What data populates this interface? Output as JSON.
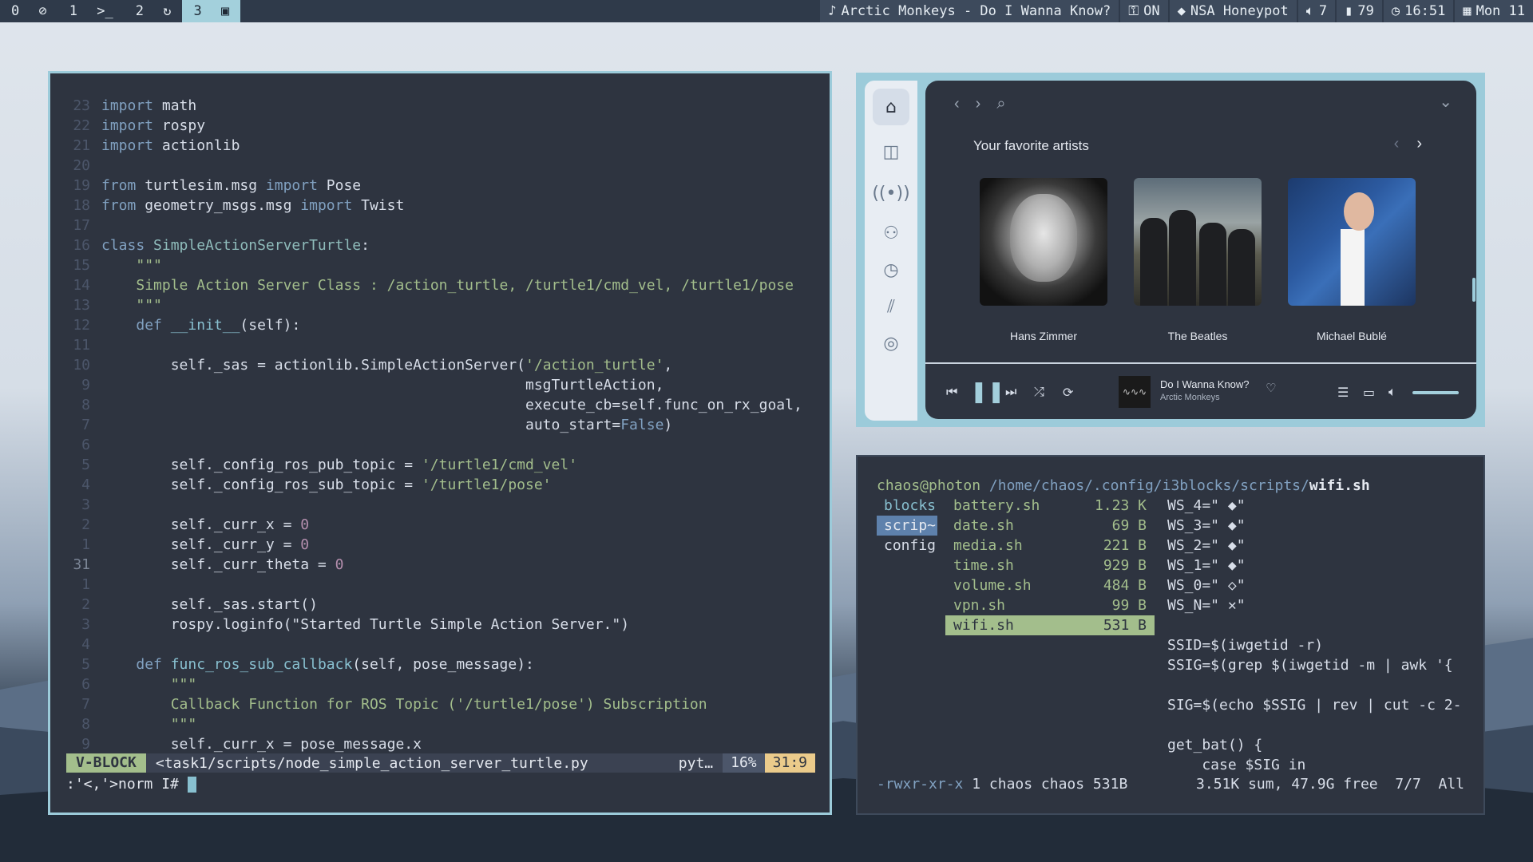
{
  "topbar": {
    "workspaces": [
      {
        "num": "0",
        "icon": "⊘"
      },
      {
        "num": "1",
        "icon": ">_"
      },
      {
        "num": "2",
        "icon": "↻"
      },
      {
        "num": "3",
        "icon": "▣",
        "active": true
      }
    ],
    "music": "Arctic Monkeys - Do I Wanna Know?",
    "vpn": "ON",
    "wifi": "NSA Honeypot",
    "volume": "7",
    "battery": "79",
    "time": "16:51",
    "date": "Mon 11"
  },
  "vim": {
    "lines": [
      {
        "n": "23",
        "c": "<span class=\"kw\">import</span> math"
      },
      {
        "n": "22",
        "c": "<span class=\"kw\">import</span> rospy"
      },
      {
        "n": "21",
        "c": "<span class=\"kw\">import</span> actionlib"
      },
      {
        "n": "20",
        "c": ""
      },
      {
        "n": "19",
        "c": "<span class=\"kw\">from</span> turtlesim.msg <span class=\"kw\">import</span> Pose"
      },
      {
        "n": "18",
        "c": "<span class=\"kw\">from</span> geometry_msgs.msg <span class=\"kw\">import</span> Twist"
      },
      {
        "n": "17",
        "c": ""
      },
      {
        "n": "16",
        "c": "<span class=\"kw\">class</span> <span class=\"cls\">SimpleActionServerTurtle</span>:"
      },
      {
        "n": "15",
        "c": "    <span class=\"doc\">\"\"\"</span>"
      },
      {
        "n": "14",
        "c": "    <span class=\"doc\">Simple Action Server Class : /action_turtle, /turtle1/cmd_vel, /turtle1/pose</span>"
      },
      {
        "n": "13",
        "c": "    <span class=\"doc\">\"\"\"</span>"
      },
      {
        "n": "12",
        "c": "    <span class=\"kw\">def</span> <span class=\"fn\">__init__</span>(self):"
      },
      {
        "n": "11",
        "c": ""
      },
      {
        "n": "10",
        "c": "        self._sas = actionlib.SimpleActionServer(<span class=\"str\">'/action_turtle'</span>,"
      },
      {
        "n": "9",
        "c": "                                                 msgTurtleAction,"
      },
      {
        "n": "8",
        "c": "                                                 execute_cb=self.func_on_rx_goal,"
      },
      {
        "n": "7",
        "c": "                                                 auto_start=<span class=\"kw\">False</span>)"
      },
      {
        "n": "6",
        "c": ""
      },
      {
        "n": "5",
        "c": "        self._config_ros_pub_topic = <span class=\"str\">'/turtle1/cmd_vel'</span>"
      },
      {
        "n": "4",
        "c": "        self._config_ros_sub_topic = <span class=\"str\">'/turtle1/pose'</span>"
      },
      {
        "n": "3",
        "c": ""
      },
      {
        "n": "2",
        "c": "        self._curr_x = <span class=\"num\">0</span>"
      },
      {
        "n": "1",
        "c": "        self._curr_y = <span class=\"num\">0</span>"
      },
      {
        "n": "31",
        "c": "        self._curr_theta = <span class=\"num\">0</span>",
        "cur": true
      },
      {
        "n": "1",
        "c": ""
      },
      {
        "n": "2",
        "c": "        self._sas.start()"
      },
      {
        "n": "3",
        "c": "        rospy.loginfo(\"Started Turtle Simple Action Server.\")"
      },
      {
        "n": "4",
        "c": ""
      },
      {
        "n": "5",
        "c": "    <span class=\"kw\">def</span> <span class=\"fn\">func_ros_sub_callback</span>(self, pose_message):"
      },
      {
        "n": "6",
        "c": "        <span class=\"doc\">\"\"\"</span>"
      },
      {
        "n": "7",
        "c": "        <span class=\"doc\">Callback Function for ROS Topic ('/turtle1/pose') Subscription</span>"
      },
      {
        "n": "8",
        "c": "        <span class=\"doc\">\"\"\"</span>"
      },
      {
        "n": "9",
        "c": "        self._curr_x = pose_message.x"
      }
    ],
    "status": {
      "mode": "V-BLOCK",
      "file": "<task1/scripts/node_simple_action_server_turtle.py",
      "filetype": "pyt…",
      "percent": "16%",
      "position": "31:9"
    },
    "cmdline": ":'<,'>norm I# "
  },
  "spotify": {
    "heading": "Your favorite artists",
    "artists": [
      "Hans Zimmer",
      "The Beatles",
      "Michael Bublé"
    ],
    "now_playing": {
      "title": "Do I Wanna Know?",
      "artist": "Arctic Monkeys"
    },
    "volume_fraction": 0.8
  },
  "terminal": {
    "prompt_user": "chaos@photon",
    "prompt_path": "/home/chaos/.config/i3blocks/scripts/",
    "prompt_file": "wifi.sh",
    "dirs": [
      "blocks",
      "scrip~",
      "config"
    ],
    "files": [
      {
        "name": "battery.sh",
        "size": "1.23 K"
      },
      {
        "name": "date.sh",
        "size": "69 B"
      },
      {
        "name": "media.sh",
        "size": "221 B"
      },
      {
        "name": "time.sh",
        "size": "929 B"
      },
      {
        "name": "volume.sh",
        "size": "484 B"
      },
      {
        "name": "vpn.sh",
        "size": "99 B"
      },
      {
        "name": "wifi.sh",
        "size": "531 B",
        "selected": true
      }
    ],
    "preview": [
      "WS_4=\" ◆\"",
      "WS_3=\" ◆\"",
      "WS_2=\" ◆\"",
      "WS_1=\" ◆\"",
      "WS_0=\" ◇\"",
      "WS_N=\" ✕\"",
      "",
      "SSID=$(iwgetid -r)",
      "SSIG=$(grep $(iwgetid -m | awk '{",
      "",
      "SIG=$(echo $SSIG | rev | cut -c 2-",
      "",
      "get_bat() {",
      "    case $SIG in"
    ],
    "footer_perm": "-rwxr-xr-x",
    "footer_info": "1 chaos chaos 531B",
    "footer_sum": "3.51K sum, 47.9G free  7/7  All"
  }
}
